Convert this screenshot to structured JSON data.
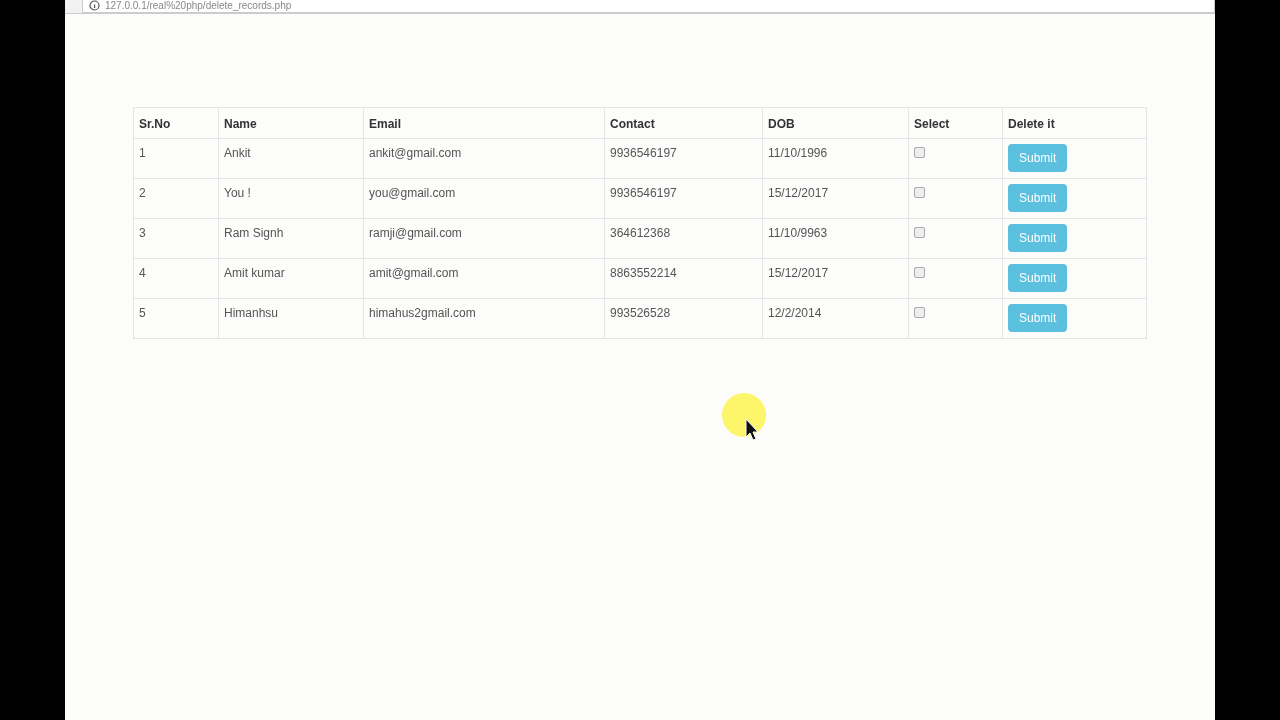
{
  "address_bar": {
    "url": "127.0.0.1/real%20php/delete_records.php"
  },
  "table": {
    "columns": [
      "Sr.No",
      "Name",
      "Email",
      "Contact",
      "DOB",
      "Select",
      "Delete it"
    ],
    "rows": [
      {
        "sr_no": "1",
        "name": "Ankit",
        "email": "ankit@gmail.com",
        "contact": "9936546197",
        "dob": "11/10/1996",
        "checked": false,
        "button": "Submit"
      },
      {
        "sr_no": "2",
        "name": "You !",
        "email": "you@gmail.com",
        "contact": "9936546197",
        "dob": "15/12/2017",
        "checked": false,
        "button": "Submit"
      },
      {
        "sr_no": "3",
        "name": "Ram Signh",
        "email": "ramji@gmail.com",
        "contact": "364612368",
        "dob": "11/10/9963",
        "checked": false,
        "button": "Submit"
      },
      {
        "sr_no": "4",
        "name": "Amit kumar",
        "email": "amit@gmail.com",
        "contact": "8863552214",
        "dob": "15/12/2017",
        "checked": false,
        "button": "Submit"
      },
      {
        "sr_no": "5",
        "name": "Himanhsu",
        "email": "himahus2gmail.com",
        "contact": "993526528",
        "dob": "12/2/2014",
        "checked": false,
        "button": "Submit"
      }
    ]
  }
}
